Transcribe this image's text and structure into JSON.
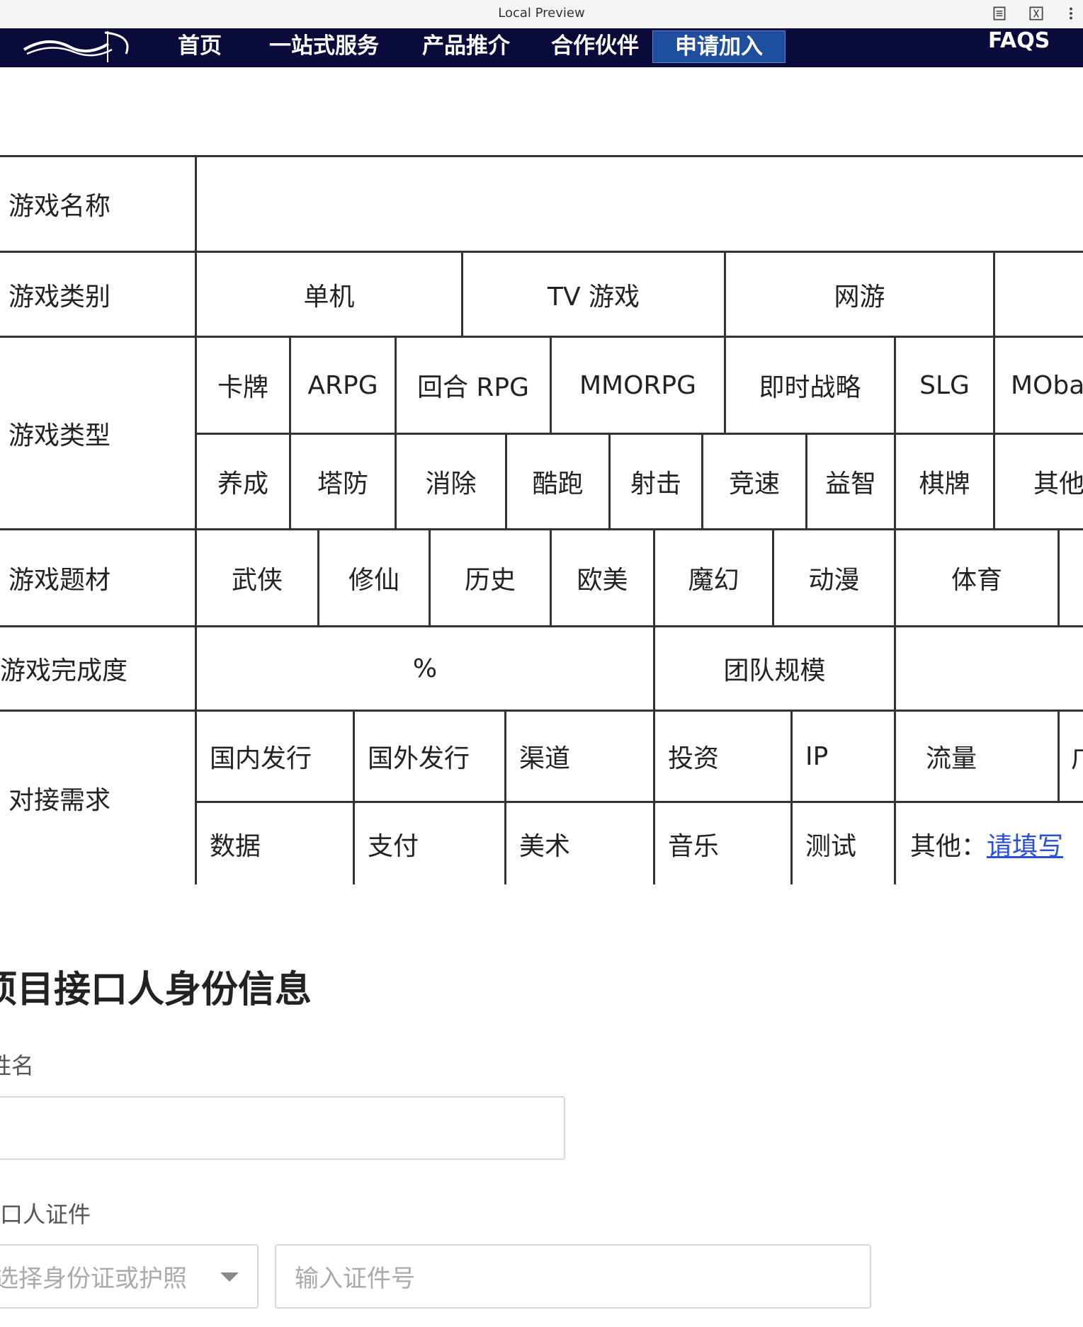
{
  "browser": {
    "title": "Local Preview"
  },
  "nav": {
    "items": [
      "首页",
      "一站式服务",
      "产品推介",
      "合作伙伴",
      "申请加入"
    ],
    "active": "申请加入",
    "faqs": "FAQS"
  },
  "form": {
    "game_name": {
      "label": "游戏名称",
      "value": ""
    },
    "category": {
      "label": "游戏类别",
      "options": [
        "单机",
        "TV 游戏",
        "网游",
        ""
      ]
    },
    "type": {
      "label": "游戏类型",
      "row1": [
        "卡牌",
        "ARPG",
        "回合 RPG",
        "MMORPG",
        "即时战略",
        "SLG",
        "MOba"
      ],
      "row2": [
        "养成",
        "塔防",
        "消除",
        "酷跑",
        "射击",
        "竞速",
        "益智",
        "棋牌",
        "其他"
      ]
    },
    "theme": {
      "label": "游戏题材",
      "options": [
        "武侠",
        "修仙",
        "历史",
        "欧美",
        "魔幻",
        "动漫",
        "体育",
        ""
      ]
    },
    "completion": {
      "label": "游戏完成度",
      "percent": "%",
      "team_label": "团队规模",
      "team_value": ""
    },
    "needs": {
      "label": "对接需求",
      "row1": [
        "国内发行",
        "国外发行",
        "渠道",
        "投资",
        "IP",
        "流量",
        "广"
      ],
      "row2": [
        "数据",
        "支付",
        "美术",
        "音乐",
        "测试"
      ],
      "other_prefix": "其他：",
      "other_link": "请填写"
    }
  },
  "identity": {
    "title": "项目接口人身份信息",
    "name_label": "姓名",
    "id_label": "接口人证件",
    "id_type_placeholder": "选择身份证或护照",
    "id_number_placeholder": "输入证件号"
  }
}
